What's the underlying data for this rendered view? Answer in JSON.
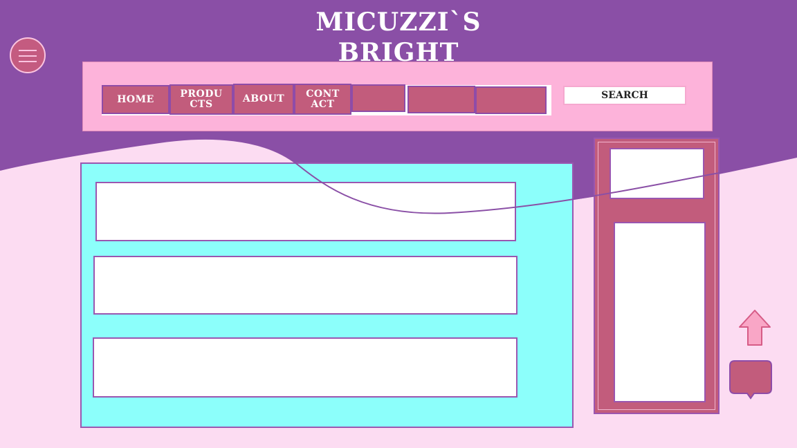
{
  "brand": {
    "line1": "Micuzzi`s",
    "line2": "Bright"
  },
  "nav": {
    "items": [
      {
        "label": "Home"
      },
      {
        "label": "Produ cts"
      },
      {
        "label": "About"
      },
      {
        "label": "Cont act"
      },
      {
        "label": ""
      },
      {
        "label": ""
      },
      {
        "label": ""
      }
    ],
    "search_label": "Search"
  },
  "colors": {
    "header_purple": "#8a4fa6",
    "navbar_pink": "#fdb3da",
    "nav_button": "#c25c7c",
    "content_cyan": "#8cfffb",
    "page_pink": "#fcdcf2"
  },
  "icons": {
    "menu": "hamburger-icon",
    "back_to_top": "up-arrow-icon",
    "chat": "chat-bubble-icon"
  }
}
